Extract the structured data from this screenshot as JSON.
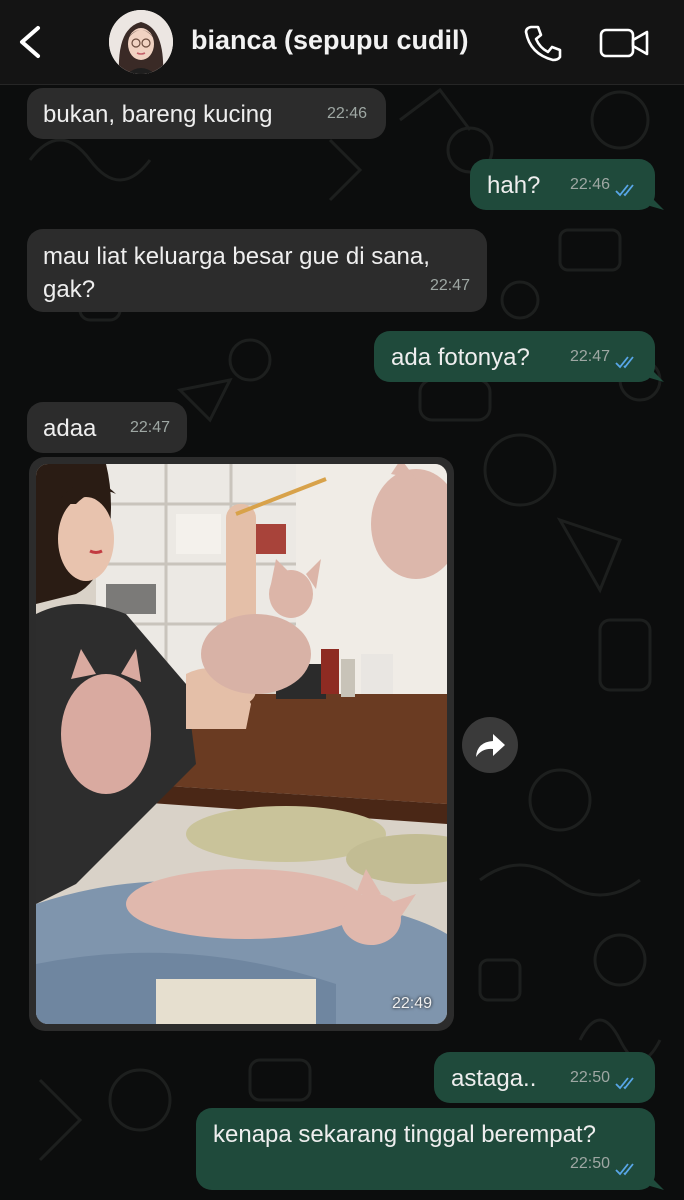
{
  "header": {
    "contact_name": "bianca (sepupu cudil)"
  },
  "icons": [
    "back-arrow-icon",
    "phone-icon",
    "video-camera-icon",
    "forward-icon",
    "double-check-icon"
  ],
  "colors": {
    "outgoing_bubble": "#1f4a3b",
    "incoming_bubble": "#2c2c2c",
    "read_ticks": "#58a6e8"
  },
  "messages": [
    {
      "direction": "incoming",
      "text": "bukan, bareng kucing",
      "time": "22:46"
    },
    {
      "direction": "outgoing",
      "text": "hah?",
      "time": "22:46",
      "read": true
    },
    {
      "direction": "incoming",
      "text": "mau liat keluarga besar gue di sana, gak?",
      "time": "22:47"
    },
    {
      "direction": "outgoing",
      "text": "ada fotonya?",
      "time": "22:47",
      "read": true
    },
    {
      "direction": "incoming",
      "text": "adaa",
      "time": "22:47"
    },
    {
      "direction": "incoming",
      "type": "image",
      "time": "22:49"
    },
    {
      "direction": "outgoing",
      "text": "astaga..",
      "time": "22:50",
      "read": true
    },
    {
      "direction": "outgoing",
      "text": "kenapa sekarang tinggal berempat?",
      "time": "22:50",
      "read": true
    }
  ]
}
